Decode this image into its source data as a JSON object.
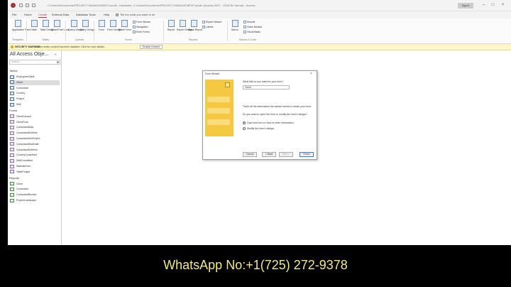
{
  "window": {
    "title": "C:\\Users\\Documents\\PROJECT-MANAGEMENT.accdb : Database- C:\\Users\\Documents\\PROJECT-MANAGEMENT.accdb (Access 2007 - 2016 file format) - Access",
    "account_label": "Sign in"
  },
  "menu": {
    "tabs": [
      "File",
      "Home",
      "Create",
      "External Data",
      "Database Tools",
      "Help"
    ],
    "active": "Create",
    "tell_me": "Tell me what you want to do"
  },
  "ribbon": {
    "templates": [
      {
        "label": "Application Parts"
      }
    ],
    "tables": [
      {
        "label": "Table"
      },
      {
        "label": "Table Design"
      },
      {
        "label": "SharePoint Lists"
      }
    ],
    "queries": [
      {
        "label": "Query Wizard"
      },
      {
        "label": "Query Design"
      }
    ],
    "forms": [
      {
        "label": "Form"
      },
      {
        "label": "Form Design"
      },
      {
        "label": "Blank Form"
      }
    ],
    "forms_small": [
      "Form Wizard",
      "Navigation",
      "More Forms"
    ],
    "reports": [
      {
        "label": "Report"
      },
      {
        "label": "Report Design"
      },
      {
        "label": "Blank Report"
      }
    ],
    "reports_small": [
      "Report Wizard",
      "Labels"
    ],
    "macros": [
      {
        "label": "Macro"
      }
    ],
    "macros_small": [
      "Module",
      "Class Module",
      "Visual Basic"
    ],
    "groups": [
      "Templates",
      "Tables",
      "Queries",
      "Forms",
      "Reports",
      "Macros & Code"
    ]
  },
  "security_bar": {
    "title": "SECURITY WARNING",
    "message": "Some active content has been disabled. Click for more details.",
    "button": "Enable Content"
  },
  "nav_pane": {
    "title": "All Access Obje...",
    "chevron": "«",
    "search_placeholder": "Search...",
    "sections": [
      {
        "header": "Tables",
        "kind": "table",
        "items": [
          "EmployeesTable",
          "Client",
          "Consultant",
          "Country",
          "Project",
          "Skill"
        ]
      },
      {
        "header": "Forms",
        "kind": "form",
        "items": [
          "ClientConsult",
          "ClientForm",
          "ConsultantData",
          "ConsultantHobbies",
          "ConsultantInfoProject",
          "ConsultantStartDate",
          "ConsultantSubform",
          "CountryConsultant",
          "SkillConsultant",
          "StatisticForm",
          "TableProject"
        ]
      },
      {
        "header": "Reports",
        "kind": "report",
        "items": [
          "Client",
          "Consultant",
          "ConsultantReview",
          "ProjectLandscape"
        ]
      }
    ],
    "selected": "Client"
  },
  "dialog": {
    "title": "Form Wizard",
    "close": "×",
    "question": "What title do you want for your form?",
    "title_value": "Client",
    "info": "That's all the information the wizard needs to create your form.",
    "prompt": "Do you want to open the form or modify the form's design?",
    "options": [
      "Open the form to view or enter information.",
      "Modify the form's design."
    ],
    "selected_option": 0,
    "buttons": [
      "Cancel",
      "< Back",
      "Next >",
      "Finish"
    ]
  },
  "caption": "WhatsApp No:+1(725) 272-9378",
  "colors": {
    "accent": "#a4373a",
    "caption": "#f2ea7c",
    "security": "#fdf6c9",
    "art": "#f5c842"
  }
}
